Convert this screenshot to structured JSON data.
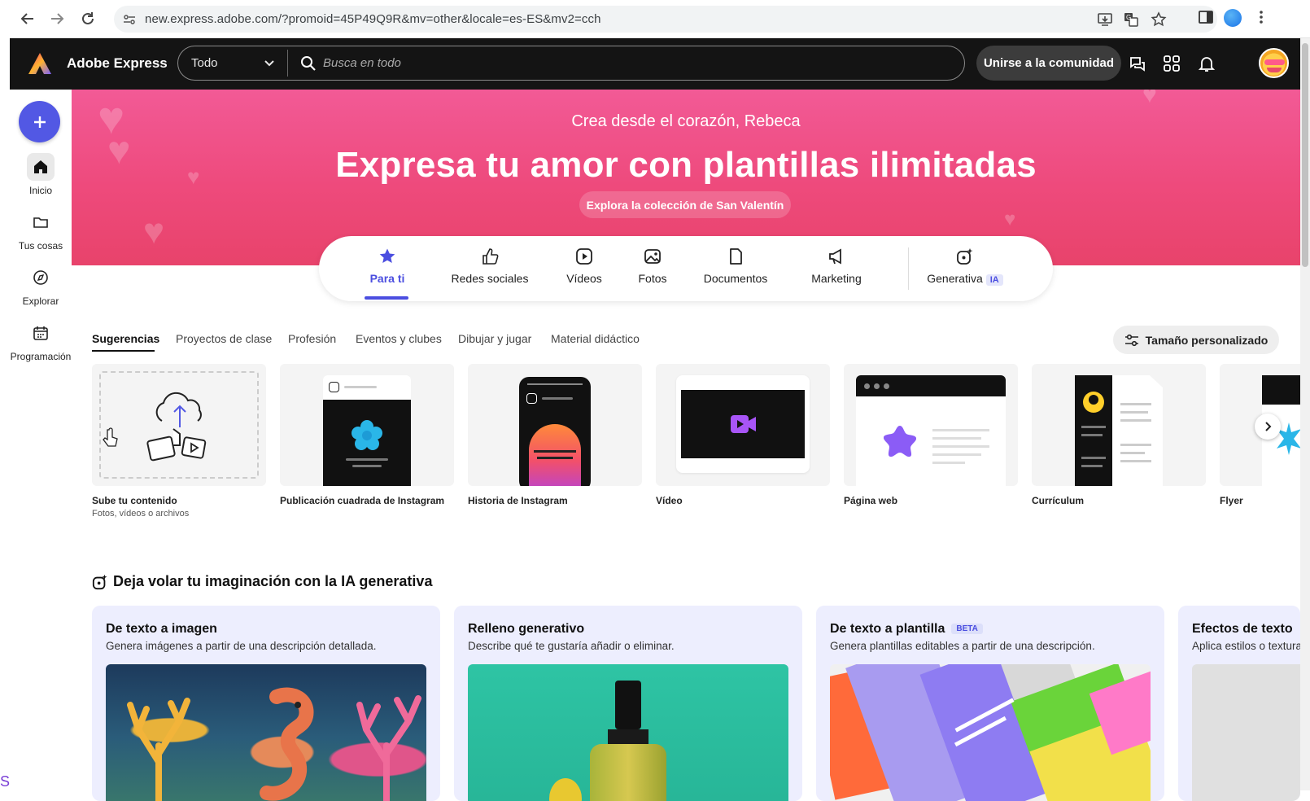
{
  "browser": {
    "url": "new.express.adobe.com/?promoid=45P49Q9R&mv=other&locale=es-ES&mv2=cch"
  },
  "header": {
    "brand": "Adobe Express",
    "search_scope": "Todo",
    "search_placeholder": "Busca en todo",
    "join_label": "Unirse a la comunidad"
  },
  "rail": {
    "items": [
      {
        "label": "Inicio",
        "icon": "home-icon"
      },
      {
        "label": "Tus cosas",
        "icon": "folder-icon"
      },
      {
        "label": "Explorar",
        "icon": "compass-icon"
      },
      {
        "label": "Programación",
        "icon": "calendar-icon"
      }
    ],
    "stray_text": "S"
  },
  "hero": {
    "subtitle": "Crea desde el corazón, Rebeca",
    "title": "Expresa tu amor con plantillas ilimitadas",
    "cta": "Explora la colección de San Valentín",
    "color": "#ee4a7c"
  },
  "categories": [
    {
      "label": "Para ti",
      "icon": "star-icon",
      "active": true
    },
    {
      "label": "Redes sociales",
      "icon": "thumbs-up-icon"
    },
    {
      "label": "Vídeos",
      "icon": "play-icon"
    },
    {
      "label": "Fotos",
      "icon": "image-icon"
    },
    {
      "label": "Documentos",
      "icon": "document-icon"
    },
    {
      "label": "Marketing",
      "icon": "megaphone-icon"
    },
    {
      "label": "Generativa",
      "icon": "sparkle-icon",
      "badge": "IA"
    }
  ],
  "subtabs": [
    {
      "label": "Sugerencias",
      "active": true
    },
    {
      "label": "Proyectos de clase"
    },
    {
      "label": "Profesión"
    },
    {
      "label": "Eventos y clubes"
    },
    {
      "label": "Dibujar y jugar"
    },
    {
      "label": "Material didáctico"
    }
  ],
  "custom_size_label": "Tamaño personalizado",
  "templates": [
    {
      "label": "Sube tu contenido",
      "sub": "Fotos, vídeos o archivos"
    },
    {
      "label": "Publicación cuadrada de Instagram"
    },
    {
      "label": "Historia de Instagram"
    },
    {
      "label": "Vídeo"
    },
    {
      "label": "Página web"
    },
    {
      "label": "Currículum"
    },
    {
      "label": "Flyer"
    }
  ],
  "ai_section": {
    "title": "Deja volar tu imaginación con la IA generativa",
    "cards": [
      {
        "title": "De texto a imagen",
        "desc": "Genera imágenes a partir de una descripción detallada."
      },
      {
        "title": "Relleno generativo",
        "desc": "Describe qué te gustaría añadir o eliminar."
      },
      {
        "title": "De texto a plantilla",
        "badge": "BETA",
        "desc": "Genera plantillas editables a partir de una descripción."
      },
      {
        "title": "Efectos de texto",
        "desc": "Aplica estilos o texturas"
      }
    ]
  },
  "accent_color": "#4b4ee0"
}
